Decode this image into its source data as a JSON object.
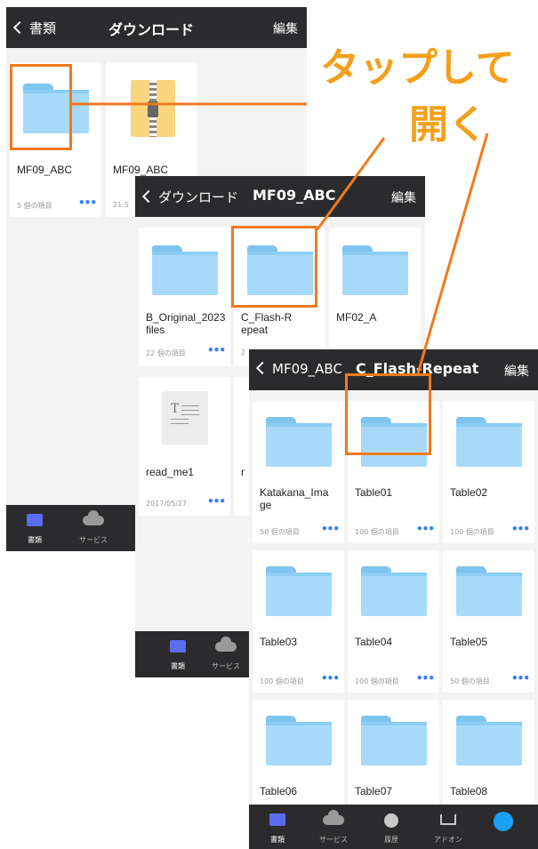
{
  "callout": {
    "line1": "タップして",
    "line2": "開く",
    "color": "#f4a01c",
    "highlight_color": "#f07a1e"
  },
  "screen1": {
    "nav": {
      "back_label": "書類",
      "title": "ダウンロード",
      "edit_label": "編集"
    },
    "items": [
      {
        "name": "MF09_ABC",
        "meta": "5 個の項目",
        "type": "folder"
      },
      {
        "name": "MF09_ABC",
        "meta": "21:5",
        "type": "zip"
      }
    ],
    "tabs": [
      {
        "label": "書類",
        "icon": "folder-icon"
      },
      {
        "label": "サービス",
        "icon": "cloud-icon"
      }
    ]
  },
  "screen2": {
    "nav": {
      "back_label": "ダウンロード",
      "title": "MF09_ABC",
      "edit_label": "編集"
    },
    "items": [
      {
        "name": "B_Original_2023files",
        "meta": "22 個の項目",
        "type": "folder"
      },
      {
        "name": "C_Flash-Repeat",
        "meta": "2",
        "type": "folder"
      },
      {
        "name": "MF02_A",
        "meta": "",
        "type": "folder"
      },
      {
        "name": "read_me1",
        "meta": "2017/05/27",
        "type": "text"
      },
      {
        "name": "r",
        "meta": "",
        "type": "folder"
      }
    ],
    "tabs": [
      {
        "label": "書類",
        "icon": "folder-icon"
      },
      {
        "label": "サービス",
        "icon": "cloud-icon"
      }
    ]
  },
  "screen3": {
    "nav": {
      "back_label": "MF09_ABC",
      "title": "C_Flash-Repeat",
      "edit_label": "編集"
    },
    "items": [
      {
        "name": "Katakana_Image",
        "meta": "50 個の項目"
      },
      {
        "name": "Table01",
        "meta": "100 個の項目"
      },
      {
        "name": "Table02",
        "meta": "100 個の項目"
      },
      {
        "name": "Table03",
        "meta": "100 個の項目"
      },
      {
        "name": "Table04",
        "meta": "100 個の項目"
      },
      {
        "name": "Table05",
        "meta": "50 個の項目"
      },
      {
        "name": "Table06",
        "meta": ""
      },
      {
        "name": "Table07",
        "meta": ""
      },
      {
        "name": "Table08",
        "meta": ""
      }
    ],
    "tabs": [
      {
        "label": "書類",
        "icon": "folder-icon"
      },
      {
        "label": "サービス",
        "icon": "cloud-icon"
      },
      {
        "label": "履歴",
        "icon": "clock-icon"
      },
      {
        "label": "アドオン",
        "icon": "cart-icon"
      },
      {
        "label": "",
        "icon": "compass-icon"
      }
    ]
  }
}
